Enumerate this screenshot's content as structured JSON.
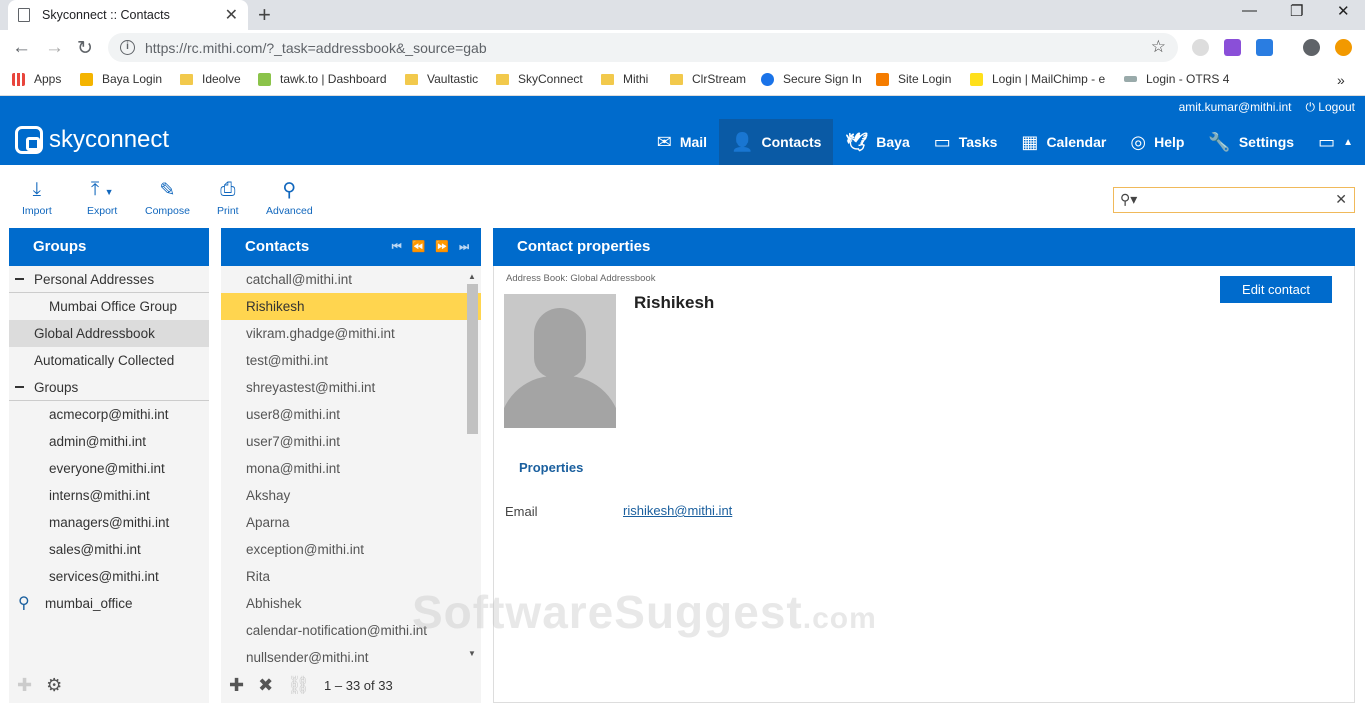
{
  "browser": {
    "tab_title": "Skyconnect :: Contacts",
    "url": "https://rc.mithi.com/?_task=addressbook&_source=gab",
    "bookmarks": [
      "Apps",
      "Baya Login",
      "Ideolve",
      "tawk.to | Dashboard",
      "Vaultastic",
      "SkyConnect",
      "Mithi",
      "ClrStream",
      "Secure Sign In",
      "Site Login",
      "Login | MailChimp - e",
      "Login - OTRS 4"
    ]
  },
  "header": {
    "logo_text": "skyconnect",
    "user_email": "amit.kumar@mithi.int",
    "logout_label": "Logout",
    "nav": [
      "Mail",
      "Contacts",
      "Baya",
      "Tasks",
      "Calendar",
      "Help",
      "Settings"
    ]
  },
  "toolbar": {
    "import": "Import",
    "export": "Export",
    "compose": "Compose",
    "print": "Print",
    "advanced": "Advanced"
  },
  "groups_panel": {
    "title": "Groups",
    "items": [
      {
        "label": "Personal Addresses"
      },
      {
        "label": "Mumbai Office Group"
      },
      {
        "label": "Global Addressbook"
      },
      {
        "label": "Automatically Collected"
      },
      {
        "label": "Groups"
      },
      {
        "label": "acmecorp@mithi.int"
      },
      {
        "label": "admin@mithi.int"
      },
      {
        "label": "everyone@mithi.int"
      },
      {
        "label": "interns@mithi.int"
      },
      {
        "label": "managers@mithi.int"
      },
      {
        "label": "sales@mithi.int"
      },
      {
        "label": "services@mithi.int"
      },
      {
        "label": "mumbai_office"
      }
    ]
  },
  "contacts_panel": {
    "title": "Contacts",
    "items": [
      "catchall@mithi.int",
      "Rishikesh",
      "vikram.ghadge@mithi.int",
      "test@mithi.int",
      "shreyastest@mithi.int",
      "user8@mithi.int",
      "user7@mithi.int",
      "mona@mithi.int",
      "Akshay",
      "Aparna",
      "exception@mithi.int",
      "Rita",
      "Abhishek",
      "calendar-notification@mithi.int",
      "nullsender@mithi.int"
    ],
    "count": "1 – 33 of 33"
  },
  "contact_props": {
    "title": "Contact properties",
    "address_book": "Address Book: Global Addressbook",
    "name": "Rishikesh",
    "edit_label": "Edit contact",
    "properties_label": "Properties",
    "email_label": "Email",
    "email_value": "rishikesh@mithi.int"
  },
  "watermark": {
    "main": "SoftwareSuggest",
    "suffix": ".com"
  }
}
